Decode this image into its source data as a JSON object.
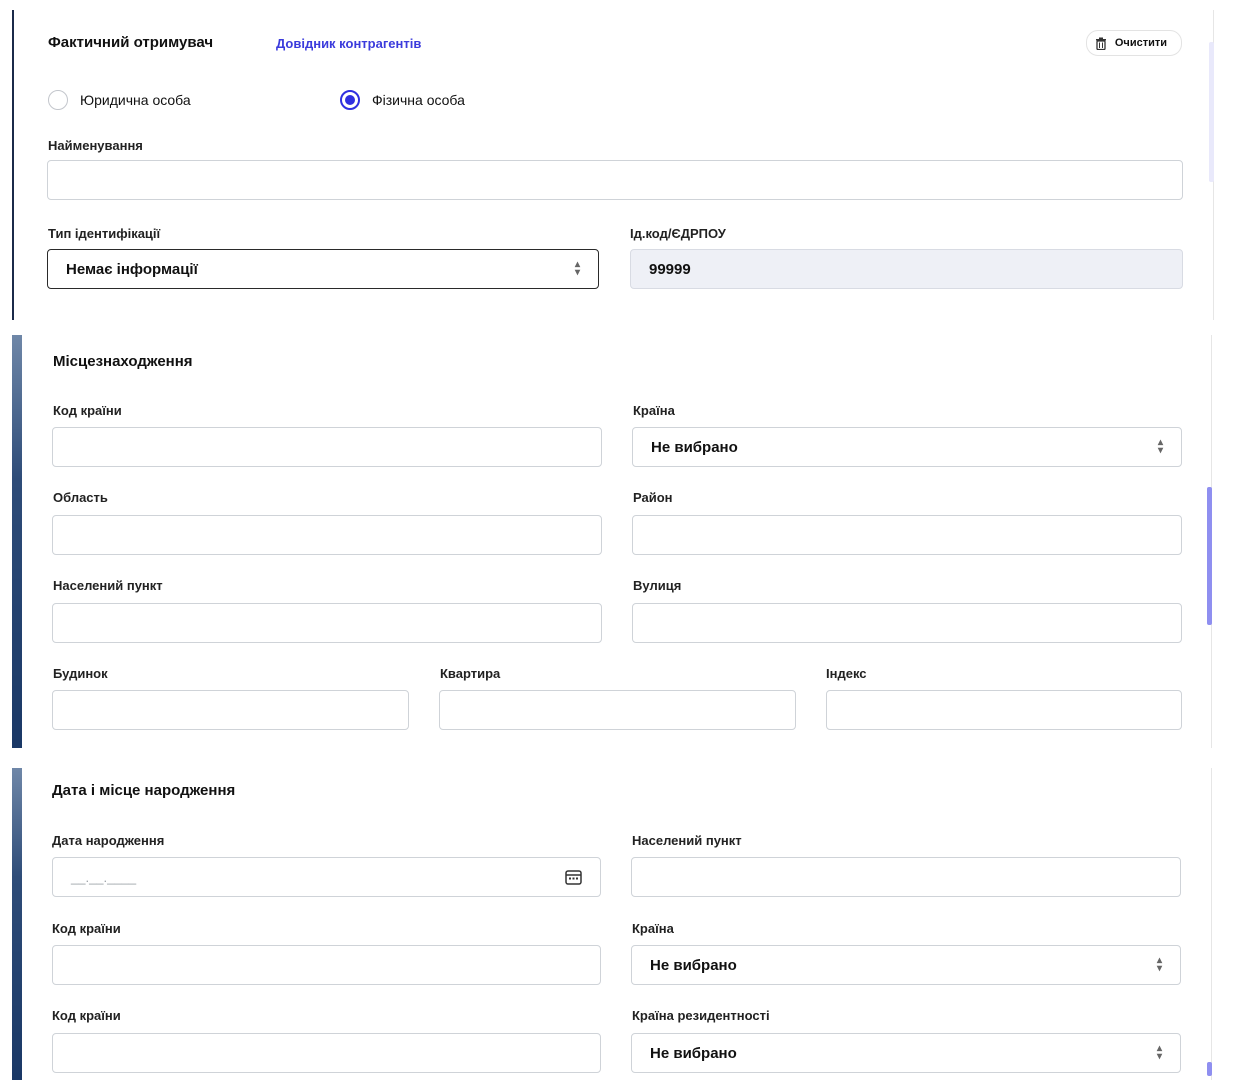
{
  "recipient": {
    "title": "Фактичний отримувач",
    "directory_link": "Довідник контрагентів",
    "clear_button": "Очистити",
    "radio_legal": "Юридична особа",
    "radio_individual": "Фізична особа",
    "radio_selected": "individual",
    "name_label": "Найменування",
    "name_value": "",
    "id_type_label": "Тип ідентифікації",
    "id_type_value": "Немає інформації",
    "id_code_label": "Ід.код/ЄДРПОУ",
    "id_code_value": "99999"
  },
  "location": {
    "title": "Місцезнаходження",
    "country_code_label": "Код країни",
    "country_label": "Країна",
    "country_value": "Не вибрано",
    "region_label": "Область",
    "district_label": "Район",
    "settlement_label": "Населений пункт",
    "street_label": "Вулиця",
    "house_label": "Будинок",
    "apartment_label": "Квартира",
    "index_label": "Індекс"
  },
  "birth": {
    "title": "Дата і місце народження",
    "birth_date_label": "Дата народження",
    "birth_date_placeholder": "__.__.____",
    "settlement_label": "Населений пункт",
    "country_code_label": "Код країни",
    "country_label": "Країна",
    "country_value": "Не вибрано",
    "country_code2_label": "Код країни",
    "residence_country_label": "Країна резидентності",
    "residence_country_value": "Не вибрано"
  },
  "colors": {
    "accent": "#2f2fe0",
    "link": "#3b3bdc",
    "scrollbar": "#8f8ff0",
    "readonly_bg": "#eef0f6"
  }
}
